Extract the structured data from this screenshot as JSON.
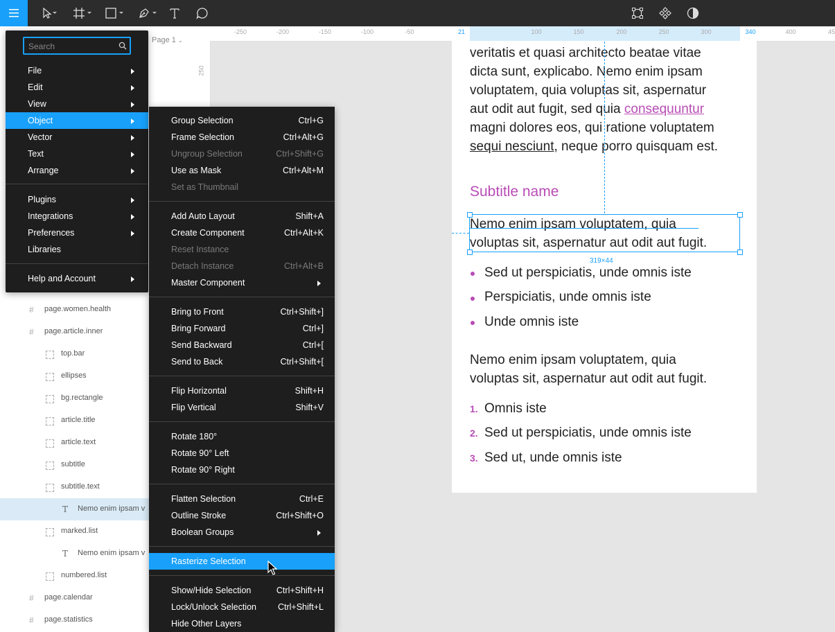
{
  "colors": {
    "accent": "#18a0fb",
    "pink": "#b84cb5",
    "toolbar": "#2c2c2c",
    "menu": "#1e1e1e"
  },
  "toolbar": {
    "left_tools": [
      "menu-icon",
      "move-tool-icon",
      "frame-tool-icon",
      "shape-tool-icon",
      "pen-tool-icon",
      "text-tool-icon",
      "comment-tool-icon"
    ],
    "right_tools": [
      "transform-icon",
      "component-icon",
      "contrast-icon"
    ]
  },
  "page_selector": {
    "label": "Page 1"
  },
  "rulers": {
    "h_ticks": [
      "-250",
      "-200",
      "-150",
      "-100",
      "-50",
      "21",
      "100",
      "150",
      "200",
      "250",
      "300",
      "340",
      "400",
      "45"
    ],
    "v_ticks": [
      "250"
    ]
  },
  "search": {
    "placeholder": "Search"
  },
  "main_menu": {
    "items": [
      {
        "label": "File",
        "submenu": true
      },
      {
        "label": "Edit",
        "submenu": true
      },
      {
        "label": "View",
        "submenu": true
      },
      {
        "label": "Object",
        "submenu": true
      },
      {
        "label": "Vector",
        "submenu": true
      },
      {
        "label": "Text",
        "submenu": true
      },
      {
        "label": "Arrange",
        "submenu": true
      },
      {
        "label": "Plugins",
        "submenu": true
      },
      {
        "label": "Integrations",
        "submenu": true
      },
      {
        "label": "Preferences",
        "submenu": true
      },
      {
        "label": "Libraries",
        "submenu": false
      },
      {
        "label": "Help and Account",
        "submenu": true
      }
    ],
    "selected": "Object"
  },
  "object_menu": {
    "items": [
      {
        "label": "Group Selection",
        "shortcut": "Ctrl+G"
      },
      {
        "label": "Frame Selection",
        "shortcut": "Ctrl+Alt+G"
      },
      {
        "label": "Ungroup Selection",
        "shortcut": "Ctrl+Shift+G",
        "disabled": true
      },
      {
        "label": "Use as Mask",
        "shortcut": "Ctrl+Alt+M"
      },
      {
        "label": "Set as Thumbnail",
        "shortcut": "",
        "disabled": true
      },
      {
        "label": "Add Auto Layout",
        "shortcut": "Shift+A"
      },
      {
        "label": "Create Component",
        "shortcut": "Ctrl+Alt+K"
      },
      {
        "label": "Reset Instance",
        "shortcut": "",
        "disabled": true
      },
      {
        "label": "Detach Instance",
        "shortcut": "Ctrl+Alt+B",
        "disabled": true
      },
      {
        "label": "Master Component",
        "shortcut": "",
        "submenu": true
      },
      {
        "label": "Bring to Front",
        "shortcut": "Ctrl+Shift+]"
      },
      {
        "label": "Bring Forward",
        "shortcut": "Ctrl+]"
      },
      {
        "label": "Send Backward",
        "shortcut": "Ctrl+["
      },
      {
        "label": "Send to Back",
        "shortcut": "Ctrl+Shift+["
      },
      {
        "label": "Flip Horizontal",
        "shortcut": "Shift+H"
      },
      {
        "label": "Flip Vertical",
        "shortcut": "Shift+V"
      },
      {
        "label": "Rotate 180°",
        "shortcut": ""
      },
      {
        "label": "Rotate 90° Left",
        "shortcut": ""
      },
      {
        "label": "Rotate 90° Right",
        "shortcut": ""
      },
      {
        "label": "Flatten Selection",
        "shortcut": "Ctrl+E"
      },
      {
        "label": "Outline Stroke",
        "shortcut": "Ctrl+Shift+O"
      },
      {
        "label": "Boolean Groups",
        "shortcut": "",
        "submenu": true
      },
      {
        "label": "Rasterize Selection",
        "shortcut": "",
        "highlighted": true
      },
      {
        "label": "Show/Hide Selection",
        "shortcut": "Ctrl+Shift+H"
      },
      {
        "label": "Lock/Unlock Selection",
        "shortcut": "Ctrl+Shift+L"
      },
      {
        "label": "Hide Other Layers",
        "shortcut": ""
      }
    ]
  },
  "layers": [
    {
      "label": "page.women.health",
      "type": "frame"
    },
    {
      "label": "page.article.inner",
      "type": "frame"
    },
    {
      "label": "top.bar",
      "type": "group"
    },
    {
      "label": "ellipses",
      "type": "group"
    },
    {
      "label": "bg.rectangle",
      "type": "group"
    },
    {
      "label": "article.title",
      "type": "group"
    },
    {
      "label": "article.text",
      "type": "group"
    },
    {
      "label": "subtitle",
      "type": "group"
    },
    {
      "label": "subtitle.text",
      "type": "group"
    },
    {
      "label": "Nemo enim ipsam v",
      "type": "text",
      "selected": true
    },
    {
      "label": "marked.list",
      "type": "group"
    },
    {
      "label": "Nemo enim ipsam v",
      "type": "text"
    },
    {
      "label": "numbered.list",
      "type": "group"
    },
    {
      "label": "page.calendar",
      "type": "frame"
    },
    {
      "label": "page.statistics",
      "type": "frame"
    }
  ],
  "canvas": {
    "paragraph_lines": [
      "veritatis et quasi architecto beatae vitae",
      "dicta sunt, explicabo. Nemo enim ipsam",
      "voluptatem, quia voluptas sit, aspernatur"
    ],
    "line4_pre": "aut odit aut fugit, sed quia ",
    "line4_link": "consequuntur",
    "line5": "magni dolores eos, qui ratione voluptatem",
    "line6_link": "sequi nesciunt",
    "line6_post": ", neque porro quisquam est.",
    "subtitle": "Subtitle name",
    "selected_text": [
      "Nemo enim ipsam voluptatem, quia",
      "voluptas sit, aspernatur aut odit aut fugit."
    ],
    "selection_size": "319×44",
    "bullets": [
      "Sed ut perspiciatis, unde omnis iste",
      "Perspiciatis, unde omnis iste",
      "Unde omnis iste"
    ],
    "paragraph2": [
      "Nemo enim ipsam voluptatem, quia",
      "voluptas sit, aspernatur aut odit aut fugit."
    ],
    "numbered": [
      {
        "num": "1.",
        "text": "Omnis iste"
      },
      {
        "num": "2.",
        "text": "Sed ut perspiciatis, unde omnis iste"
      },
      {
        "num": "3.",
        "text": "Sed ut, unde omnis iste"
      }
    ]
  }
}
